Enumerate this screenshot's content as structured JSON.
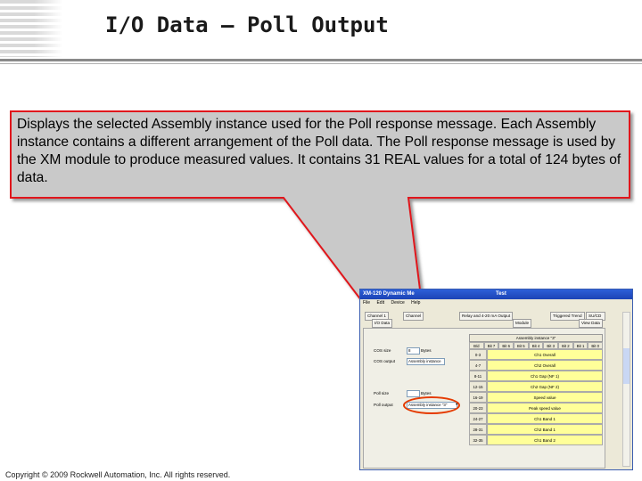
{
  "slide": {
    "title": "I/O Data – Poll Output",
    "callout": "Displays the selected Assembly instance used for the Poll response message. Each Assembly instance contains a different arrangement of the Poll data.  The Poll response message is used by the XM module to produce measured values. It contains 31 REAL values for a total of 124 bytes of data.",
    "footer": "Copyright © 2009 Rockwell Automation, Inc. All rights reserved."
  },
  "colors": {
    "callout_fill": "#c9c9c9",
    "callout_border": "#e0191b",
    "highlight": "#e53a00",
    "cell_fill": "#ffff99",
    "titlebar": "#2d5fd8"
  },
  "window": {
    "title_left": "XM-120 Dynamic Me",
    "title_right": "Test",
    "menu": [
      "File",
      "Edit",
      "Device",
      "Help"
    ],
    "tabs_row1": [
      {
        "label": "Channel 1"
      },
      {
        "label": "Channel"
      },
      {
        "label": "Relay and 4-20 mA Output"
      },
      {
        "label": "Triggered Trend"
      },
      {
        "label": "SU/CD Trend"
      }
    ],
    "tabs_row2": [
      {
        "label": "I/O Data"
      },
      {
        "label": "Module"
      },
      {
        "label": "View Data"
      }
    ],
    "fields": [
      {
        "label": "COS size",
        "value": "8",
        "unit": "Bytes"
      },
      {
        "label": "COS output",
        "value": "Assembly instance"
      },
      {
        "label": "Poll size",
        "value": "",
        "unit": "Bytes"
      },
      {
        "label": "Poll output",
        "value": "Assembly instance \"3\""
      }
    ],
    "grid": {
      "caption": "Assembly instance \"3\"",
      "corner": "B/d",
      "bits": [
        "Bit 7",
        "Bit 6",
        "Bit 5",
        "Bit 4",
        "Bit 3",
        "Bit 2",
        "Bit 1",
        "Bit 0"
      ],
      "rows": [
        {
          "bytes": "0-3",
          "value": "Ch1 Overall"
        },
        {
          "bytes": "4-7",
          "value": "Ch2 Overall"
        },
        {
          "bytes": "8-11",
          "value": "Ch1 Gap (NF 1)"
        },
        {
          "bytes": "12-15",
          "value": "Ch2 Gap (NF 2)"
        },
        {
          "bytes": "16-19",
          "value": "Speed value"
        },
        {
          "bytes": "20-23",
          "value": "Peak speed value"
        },
        {
          "bytes": "24-27",
          "value": "Ch1 Band 1"
        },
        {
          "bytes": "28-31",
          "value": "Ch2 Band 1"
        },
        {
          "bytes": "32-35",
          "value": "Ch1 Band 2"
        }
      ]
    }
  }
}
